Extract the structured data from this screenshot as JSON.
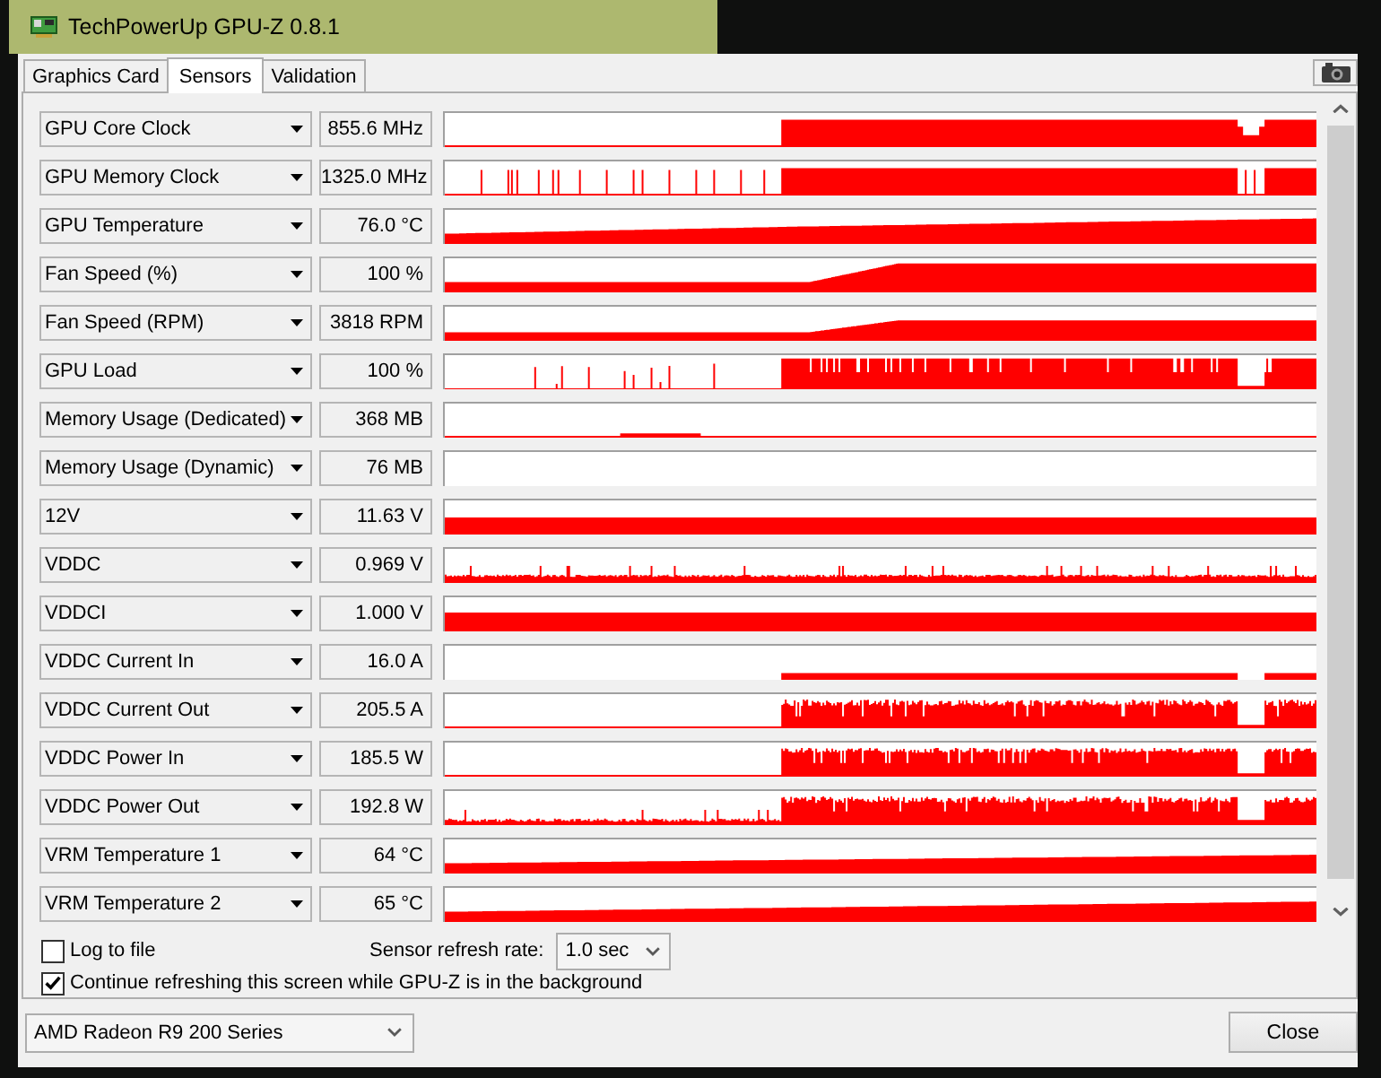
{
  "window": {
    "title": "TechPowerUp GPU-Z 0.8.1"
  },
  "tabs": [
    {
      "label": "Graphics Card",
      "selected": false
    },
    {
      "label": "Sensors",
      "selected": true
    },
    {
      "label": "Validation",
      "selected": false
    }
  ],
  "sensors": [
    {
      "name": "GPU Core Clock",
      "reading": "855.6 MHz"
    },
    {
      "name": "GPU Memory Clock",
      "reading": "1325.0 MHz"
    },
    {
      "name": "GPU Temperature",
      "reading": "76.0 °C"
    },
    {
      "name": "Fan Speed (%)",
      "reading": "100 %"
    },
    {
      "name": "Fan Speed (RPM)",
      "reading": "3818 RPM"
    },
    {
      "name": "GPU Load",
      "reading": "100 %"
    },
    {
      "name": "Memory Usage (Dedicated)",
      "reading": "368 MB"
    },
    {
      "name": "Memory Usage (Dynamic)",
      "reading": "76 MB"
    },
    {
      "name": "12V",
      "reading": "11.63 V"
    },
    {
      "name": "VDDC",
      "reading": "0.969 V"
    },
    {
      "name": "VDDCI",
      "reading": "1.000 V"
    },
    {
      "name": "VDDC Current In",
      "reading": "16.0 A"
    },
    {
      "name": "VDDC Current Out",
      "reading": "205.5 A"
    },
    {
      "name": "VDDC Power In",
      "reading": "185.5 W"
    },
    {
      "name": "VDDC Power Out",
      "reading": "192.8 W"
    },
    {
      "name": "VRM Temperature 1",
      "reading": "64 °C"
    },
    {
      "name": "VRM Temperature 2",
      "reading": "65 °C"
    }
  ],
  "log_to_file": {
    "label": "Log to file",
    "checked": false
  },
  "refresh_rate": {
    "label": "Sensor refresh rate:",
    "value": "1.0 sec"
  },
  "background_refresh": {
    "label": "Continue refreshing this screen while GPU-Z is in the background",
    "checked": true
  },
  "device_select": {
    "value": "AMD Radeon R9 200 Series"
  },
  "buttons": [
    {
      "label": "Close"
    }
  ]
}
